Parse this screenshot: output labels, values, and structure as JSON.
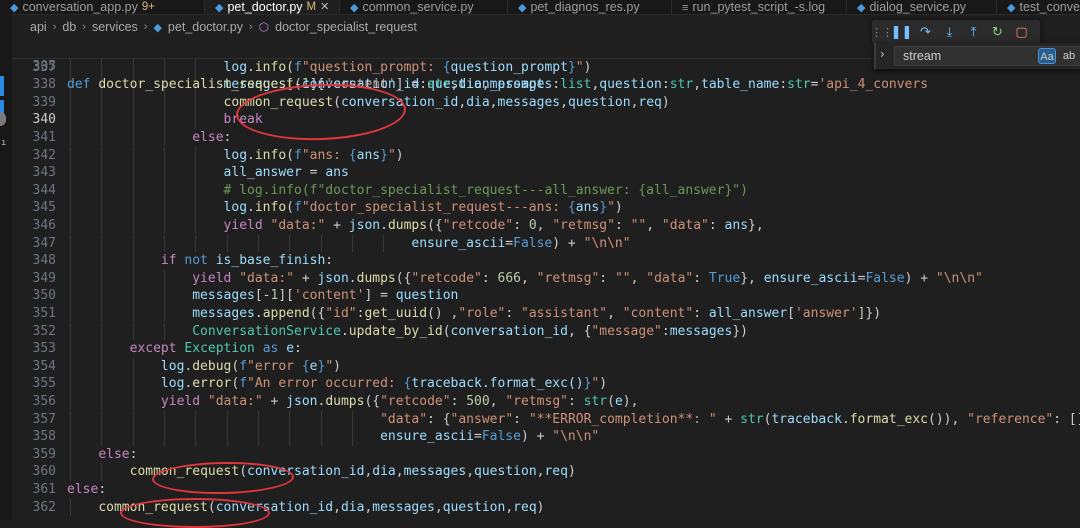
{
  "tabs": [
    {
      "label": "conversation_app.py",
      "badge": "9+",
      "active": false
    },
    {
      "label": "pet_doctor.py",
      "badge": "M",
      "active": true
    },
    {
      "label": "common_service.py",
      "badge": "",
      "active": false
    },
    {
      "label": "pet_diagnos_res.py",
      "badge": "",
      "active": false
    },
    {
      "label": "run_pytest_script_-s.log",
      "badge": "",
      "active": false
    },
    {
      "label": "dialog_service.py",
      "badge": "",
      "active": false
    },
    {
      "label": "test_conver",
      "badge": "",
      "active": false
    }
  ],
  "breadcrumb": {
    "items": [
      "api",
      "db",
      "services",
      "pet_doctor.py",
      "doctor_specialist_request"
    ]
  },
  "find": {
    "query": "stream",
    "match_case_label": "Aa",
    "whole_word_label": "ab"
  },
  "sticky": {
    "line_number": "305",
    "code": "def doctor_specialist_request(conversation_id:str,dia,messages:list,question:str,table_name:str='api_4_convers"
  },
  "editor": {
    "current_line": "340",
    "lines": [
      {
        "n": "337",
        "code": "                    log.info(f\"question_prompt: {question_prompt}\")"
      },
      {
        "n": "338",
        "code": "                    messages[-1]['content'] = question_prompt"
      },
      {
        "n": "339",
        "code": "                    common_request(conversation_id,dia,messages,question,req)"
      },
      {
        "n": "340",
        "code": "                    break"
      },
      {
        "n": "341",
        "code": "                else:"
      },
      {
        "n": "342",
        "code": "                    log.info(f\"ans: {ans}\")"
      },
      {
        "n": "343",
        "code": "                    all_answer = ans"
      },
      {
        "n": "344",
        "code": "                    # log.info(f\"doctor_specialist_request---all_answer: {all_answer}\")"
      },
      {
        "n": "345",
        "code": "                    log.info(f\"doctor_specialist_request---ans: {ans}\")"
      },
      {
        "n": "346",
        "code": "                    yield \"data:\" + json.dumps({\"retcode\": 0, \"retmsg\": \"\", \"data\": ans},"
      },
      {
        "n": "347",
        "code": "                                            ensure_ascii=False) + \"\\n\\n\""
      },
      {
        "n": "348",
        "code": "            if not is_base_finish:"
      },
      {
        "n": "349",
        "code": "                yield \"data:\" + json.dumps({\"retcode\": 666, \"retmsg\": \"\", \"data\": True}, ensure_ascii=False) + \"\\n\\n\""
      },
      {
        "n": "350",
        "code": "                messages[-1]['content'] = question"
      },
      {
        "n": "351",
        "code": "                messages.append({\"id\":get_uuid() ,\"role\": \"assistant\", \"content\": all_answer['answer']})"
      },
      {
        "n": "352",
        "code": "                ConversationService.update_by_id(conversation_id, {\"message\":messages})"
      },
      {
        "n": "353",
        "code": "        except Exception as e:"
      },
      {
        "n": "354",
        "code": "            log.debug(f\"error {e}\")"
      },
      {
        "n": "355",
        "code": "            log.error(f\"An error occurred: {traceback.format_exc()}\")"
      },
      {
        "n": "356",
        "code": "            yield \"data:\" + json.dumps({\"retcode\": 500, \"retmsg\": str(e),"
      },
      {
        "n": "357",
        "code": "                                        \"data\": {\"answer\": \"**ERROR_completion**: \" + str(traceback.format_exc()), \"reference\": []}},"
      },
      {
        "n": "358",
        "code": "                                        ensure_ascii=False) + \"\\n\\n\""
      },
      {
        "n": "359",
        "code": "    else:"
      },
      {
        "n": "360",
        "code": "        common_request(conversation_id,dia,messages,question,req)"
      },
      {
        "n": "361",
        "code": "else:"
      },
      {
        "n": "362",
        "code": "    common_request(conversation_id,dia,messages,question,req)"
      }
    ]
  },
  "colors": {
    "annotation": "#e0373d",
    "background": "#1f1f1f",
    "keyword": "#569cd6",
    "control": "#c586c0",
    "function": "#dcdcaa",
    "string": "#ce9178"
  }
}
